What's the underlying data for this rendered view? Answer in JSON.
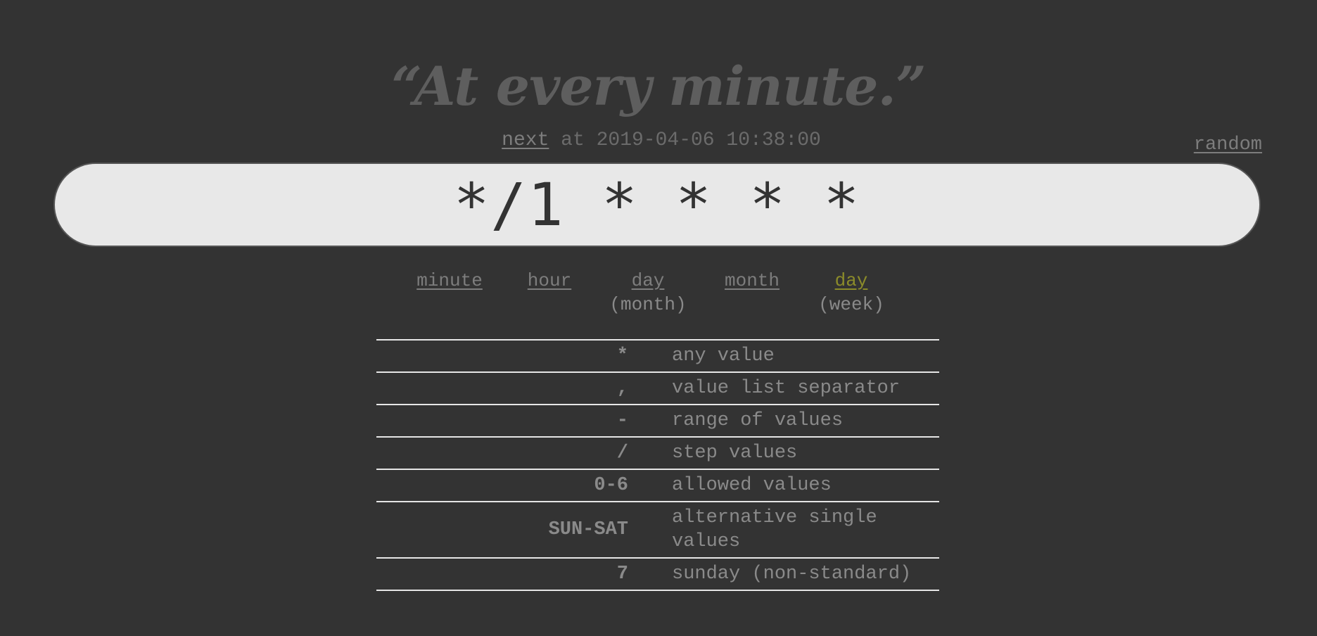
{
  "header": {
    "description": "“At every minute.”",
    "next_link": "next",
    "next_text": " at 2019-04-06 10:38:00",
    "random_link": "random"
  },
  "cron": {
    "expression": "*/1 * * * *"
  },
  "units": [
    {
      "label": "minute",
      "sub": ""
    },
    {
      "label": "hour",
      "sub": ""
    },
    {
      "label": "day",
      "sub": "(month)"
    },
    {
      "label": "month",
      "sub": ""
    },
    {
      "label": "day",
      "sub": "(week)",
      "active": true
    }
  ],
  "reference": [
    {
      "symbol": "*",
      "meaning": "any value"
    },
    {
      "symbol": ",",
      "meaning": "value list separator"
    },
    {
      "symbol": "-",
      "meaning": "range of values"
    },
    {
      "symbol": "/",
      "meaning": "step values"
    },
    {
      "symbol": "0-6",
      "meaning": "allowed values"
    },
    {
      "symbol": "SUN-SAT",
      "meaning": "alternative single values"
    },
    {
      "symbol": "7",
      "meaning": "sunday (non-standard)"
    }
  ],
  "colors": {
    "background": "#333333",
    "input_background": "#e8e8e8",
    "active_unit": "#8b8b2a"
  }
}
